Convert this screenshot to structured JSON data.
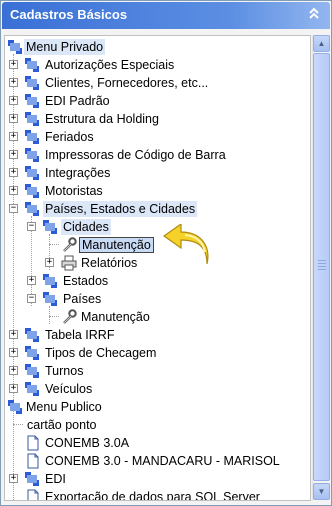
{
  "panel": {
    "title": "Cadastros Básicos",
    "collapse_icon": "double-chevron-up-icon"
  },
  "tree": {
    "root_privado": "Menu Privado",
    "privado_items": [
      "Autorizações Especiais",
      "Clientes, Fornecedores, etc...",
      "EDI Padrão",
      "Estrutura da Holding",
      "Feriados",
      "Impressoras de Código de Barra",
      "Integrações",
      "Motoristas",
      "Países, Estados e Cidades"
    ],
    "cidades": "Cidades",
    "cidades_manutencao": "Manutenção",
    "relatorios": "Relatórios",
    "estados": "Estados",
    "paises": "Países",
    "paises_manutencao": "Manutenção",
    "privado_items_after": [
      "Tabela IRRF",
      "Tipos de Checagem",
      "Turnos",
      "Veículos"
    ],
    "root_publico": "Menu Publico",
    "publico_items": [
      "cartão ponto",
      "CONEMB 3.0A",
      "CONEMB 3.0 - MANDACARU - MARISOL",
      "EDI",
      "Exportação de dados para SQL Server"
    ]
  },
  "colors": {
    "title_bar": "#3a70d6",
    "selection": "#c9daf4",
    "arrow": "#f2cc30"
  }
}
